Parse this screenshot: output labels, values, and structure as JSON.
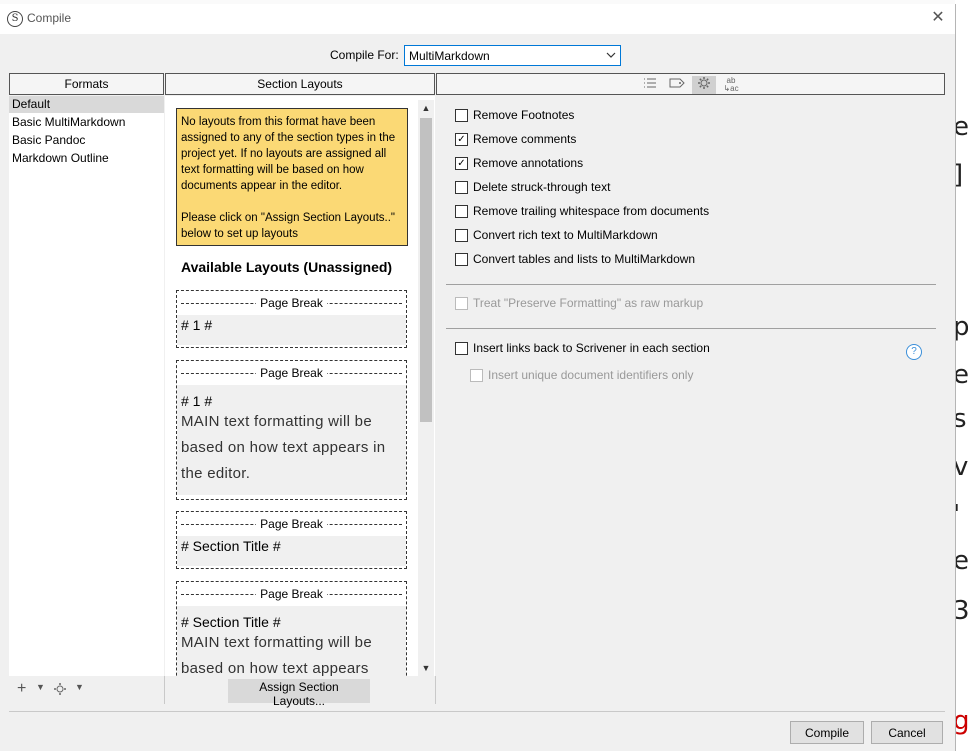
{
  "window": {
    "title": "Compile",
    "app_icon": "S"
  },
  "compile_for": {
    "label": "Compile For:",
    "value": "MultiMarkdown"
  },
  "formats": {
    "header": "Formats",
    "items": [
      "Default",
      "Basic MultiMarkdown",
      "Basic Pandoc",
      "Markdown Outline"
    ],
    "selected": "Default"
  },
  "section_layouts": {
    "header": "Section Layouts",
    "notice": "No layouts from this format have been assigned to any of the section types in the project yet. If no layouts are assigned all text formatting will be based on how documents appear in the editor.",
    "notice2": "Please click on \"Assign Section Layouts..\" below to set up layouts",
    "available_heading": "Available Layouts (Unassigned)",
    "cards": [
      {
        "page_break": "Page Break",
        "title": "# 1 #",
        "main": ""
      },
      {
        "page_break": "Page Break",
        "title": "# 1 #",
        "main": "MAIN text formatting will be based on how text appears in the editor."
      },
      {
        "page_break": "Page Break",
        "title": "# Section Title #",
        "main": ""
      },
      {
        "page_break": "Page Break",
        "title": "# Section Title #",
        "main": "MAIN text formatting will be based on how text appears"
      }
    ],
    "assign_button": "Assign Section Layouts..."
  },
  "settings": {
    "tab_icons": [
      "list-icon",
      "tag-icon",
      "gear-icon",
      "replace-icon"
    ],
    "replace_tab_glyph_top": "ab",
    "replace_tab_glyph_bottom": "↳ac",
    "options": [
      {
        "label": "Remove Footnotes",
        "checked": false
      },
      {
        "label": "Remove comments",
        "checked": true
      },
      {
        "label": "Remove annotations",
        "checked": true
      },
      {
        "label": "Delete struck-through text",
        "checked": false
      },
      {
        "label": "Remove trailing whitespace from documents",
        "checked": false
      },
      {
        "label": "Convert rich text to MultiMarkdown",
        "checked": false
      },
      {
        "label": "Convert tables and lists to MultiMarkdown",
        "checked": false
      }
    ],
    "preserve_formatting": {
      "label": "Treat \"Preserve Formatting\" as raw markup",
      "checked": false,
      "enabled": false
    },
    "insert_links": {
      "label": "Insert links back to Scrivener in each section",
      "checked": false
    },
    "unique_ids": {
      "label": "Insert unique document identifiers only",
      "checked": false,
      "enabled": false
    }
  },
  "footer": {
    "compile": "Compile",
    "cancel": "Cancel"
  }
}
